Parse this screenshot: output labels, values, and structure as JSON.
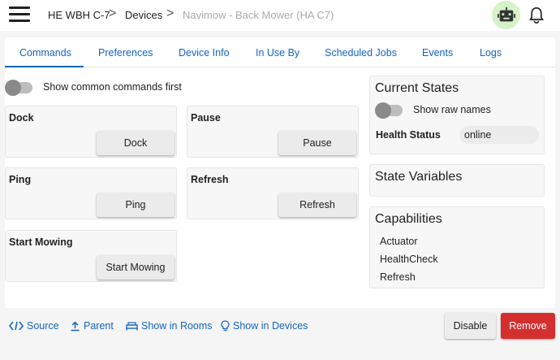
{
  "header": {
    "breadcrumbs": [
      "HE WBH C-7",
      "Devices",
      "Navimow - Back Mower (HA C7)"
    ],
    "separator": ">",
    "icons": [
      "menu-icon",
      "robot-icon",
      "bell-icon"
    ]
  },
  "tabs": [
    {
      "label": "Commands",
      "active": true
    },
    {
      "label": "Preferences"
    },
    {
      "label": "Device Info"
    },
    {
      "label": "In Use By"
    },
    {
      "label": "Scheduled Jobs"
    },
    {
      "label": "Events"
    },
    {
      "label": "Logs"
    }
  ],
  "commands": {
    "toggle_label": "Show common commands first",
    "toggle_on": false,
    "items": [
      {
        "title": "Dock",
        "button": "Dock"
      },
      {
        "title": "Pause",
        "button": "Pause"
      },
      {
        "title": "Ping",
        "button": "Ping"
      },
      {
        "title": "Refresh",
        "button": "Refresh"
      },
      {
        "title": "Start Mowing",
        "button": "Start Mowing"
      }
    ]
  },
  "current_states": {
    "title": "Current States",
    "toggle_label": "Show raw names",
    "toggle_on": false,
    "health_label": "Health Status",
    "health_value": "online"
  },
  "state_variables": {
    "title": "State Variables"
  },
  "capabilities": {
    "title": "Capabilities",
    "items": [
      "Actuator",
      "HealthCheck",
      "Refresh"
    ]
  },
  "footer": {
    "links": [
      {
        "label": "Source",
        "icon": "code-icon"
      },
      {
        "label": "Parent",
        "icon": "upload-icon"
      },
      {
        "label": "Show in Rooms",
        "icon": "bed-icon"
      },
      {
        "label": "Show in Devices",
        "icon": "lightbulb-icon"
      }
    ],
    "disable_label": "Disable",
    "remove_label": "Remove"
  },
  "colors": {
    "accent": "#1565c0",
    "danger": "#d32f2f",
    "robot_bg": "#d6f2c8"
  }
}
